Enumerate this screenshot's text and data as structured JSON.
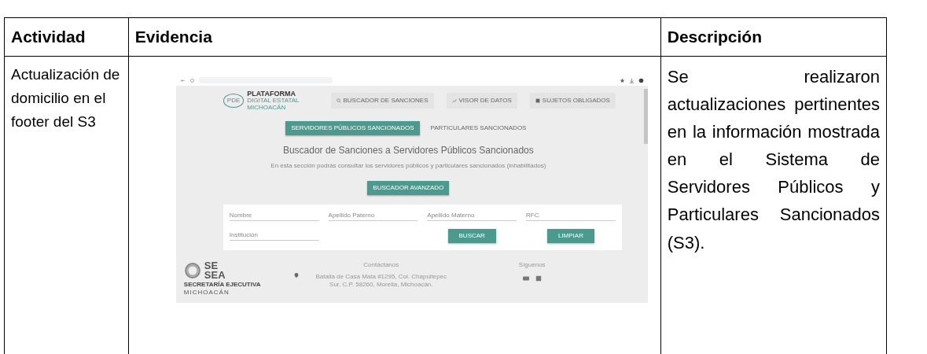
{
  "table": {
    "columns": [
      "Actividad",
      "Evidencia",
      "Descripción"
    ],
    "rows": [
      {
        "actividad": "Actualización de domicilio en el footer del S3",
        "evidencia": {
          "nav_items": [
            {
              "label": "BUSCADOR DE SANCIONES",
              "kind": "search"
            },
            {
              "label": "VISOR DE DATOS",
              "kind": "chart"
            },
            {
              "label": "SUJETOS OBLIGADOS",
              "kind": "grid"
            }
          ],
          "logo": {
            "title": "PLATAFORMA",
            "subtitle": "DIGITAL ESTATAL",
            "region": "MICHOACÁN",
            "mark": "PDE"
          },
          "tabs": [
            {
              "label": "SERVIDORES PÚBLICOS SANCIONADOS",
              "selected": true
            },
            {
              "label": "PARTICULARES SANCIONADOS",
              "selected": false
            }
          ],
          "title": "Buscador de Sanciones a Servidores Públicos Sancionados",
          "subtitle": "En esta sección podrás consultar los servidores públicos y particulares sancionados (inhabilitados)",
          "advanced_button": "BUSCADOR AVANZADO",
          "fields": [
            {
              "placeholder": "Nombre"
            },
            {
              "placeholder": "Apellido Paterno"
            },
            {
              "placeholder": "Apellido Materno"
            },
            {
              "placeholder": "RFC"
            },
            {
              "placeholder": "Institución"
            }
          ],
          "buttons": [
            "BUSCAR",
            "LIMPIAR"
          ],
          "footer": {
            "logo_top": "SE",
            "logo_bottom": "SEA",
            "logo_caption": "SECRETARÍA EJECUTIVA",
            "logo_region": "MICHOACÁN",
            "contact_title": "Contáctanos",
            "address": "Batalla de Casa Mata #1295, Col. Chapultepec Sur, C.P. 58260, Morelia, Michoacán.",
            "follow_title": "Síguenos"
          }
        },
        "descripcion": "Se realizaron actualizaciones pertinentes en la información mostrada en el Sistema de Servidores Públicos y Particulares Sancionados (S3)."
      }
    ]
  }
}
